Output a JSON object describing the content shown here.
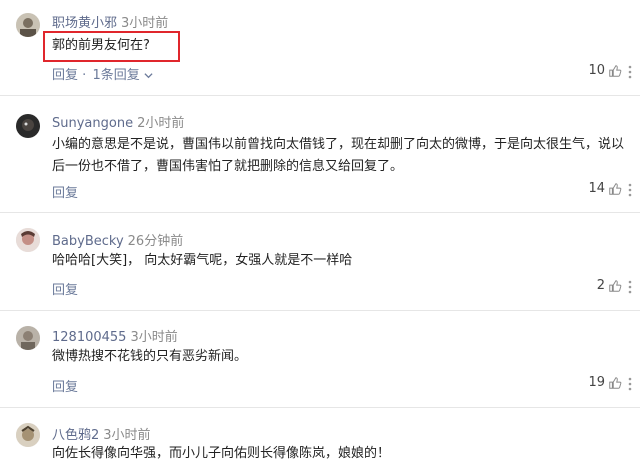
{
  "comments": [
    {
      "user": "职场黄小邪",
      "time": "3小时前",
      "lines": [
        "郭的前男友何在?"
      ],
      "reply_label": "回复",
      "reply_sep": "·",
      "more_replies": "1条回复",
      "likes": "10"
    },
    {
      "user": "Sunyangone",
      "time": "2小时前",
      "lines": [
        "小编的意思是不是说，曹国伟以前曾找向太借钱了，现在却删了向太的微博，于是向太很生气，说以",
        "后一份也不借了，曹国伟害怕了就把删除的信息又给回复了。"
      ],
      "reply_label": "回复",
      "likes": "14"
    },
    {
      "user": "BabyBecky",
      "time": "26分钟前",
      "lines": [
        "哈哈哈[大笑]， 向太好霸气呢，女强人就是不一样哈"
      ],
      "reply_label": "回复",
      "likes": "2"
    },
    {
      "user": "128100455",
      "time": "3小时前",
      "lines": [
        "微博热搜不花钱的只有恶劣新闻。"
      ],
      "reply_label": "回复",
      "likes": "19"
    },
    {
      "user": "八色鸦2",
      "time": "3小时前",
      "lines": [
        "向佐长得像向华强，而小儿子向佑则长得像陈岚，娘娘的！"
      ]
    }
  ],
  "colors": {
    "username": "#5f6b8c",
    "reply": "#6b7a9a",
    "highlight": "#e0262c"
  },
  "icons": [
    "thumbs-up-icon",
    "more-options-icon",
    "chevron-down-icon"
  ]
}
